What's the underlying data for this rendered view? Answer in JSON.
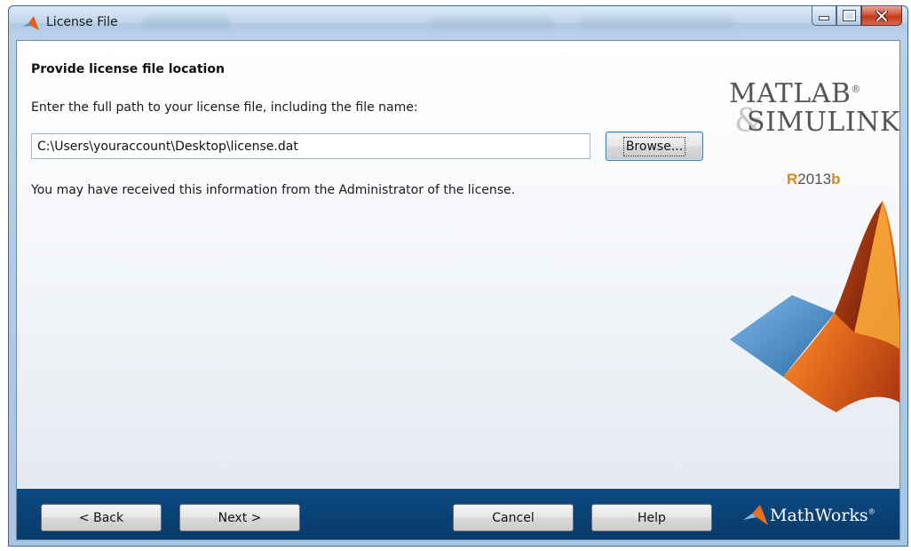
{
  "window": {
    "title": "License File",
    "controls": {
      "minimize": "minimize",
      "maximize": "maximize",
      "close": "close"
    }
  },
  "page": {
    "heading": "Provide license file location",
    "instruction": "Enter the full path to your license file, including the file name:",
    "path_value": "C:\\Users\\youraccount\\Desktop\\license.dat",
    "browse_label": "Browse...",
    "info": "You may have received this information from the Administrator of the license."
  },
  "branding": {
    "matlab": "MATLAB",
    "simulink": "SIMULINK",
    "registered": "®",
    "release_r": "R",
    "release_year": "2013",
    "release_letter": "b",
    "mathworks": "MathWorks"
  },
  "footer": {
    "back_label": "< Back",
    "next_label": "Next >",
    "cancel_label": "Cancel",
    "help_label": "Help"
  },
  "colors": {
    "footer_bg": "#0a4276",
    "release_accent": "#d78a15",
    "close_button": "#c4381c"
  },
  "icons": [
    "matlab-logo-icon",
    "minimize-icon",
    "maximize-icon",
    "close-icon",
    "mathworks-logo-icon",
    "matlab-membrane-logo"
  ]
}
